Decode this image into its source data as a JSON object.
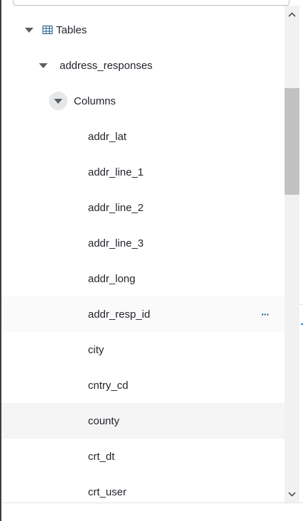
{
  "tree": {
    "tables_label": "Tables",
    "table_name": "address_responses",
    "columns_label": "Columns",
    "columns": [
      "addr_lat",
      "addr_line_1",
      "addr_line_2",
      "addr_line_3",
      "addr_long",
      "addr_resp_id",
      "city",
      "cntry_cd",
      "county",
      "crt_dt",
      "crt_user"
    ],
    "more_actions_glyph": "···"
  },
  "scrollbar": {
    "up_glyph": "∧",
    "down_glyph": "∨"
  },
  "colors": {
    "accent": "#1a5c8a",
    "text": "#1f2329",
    "selected_row": "#f5f5f5",
    "scroll_thumb": "#c1c1c1"
  }
}
